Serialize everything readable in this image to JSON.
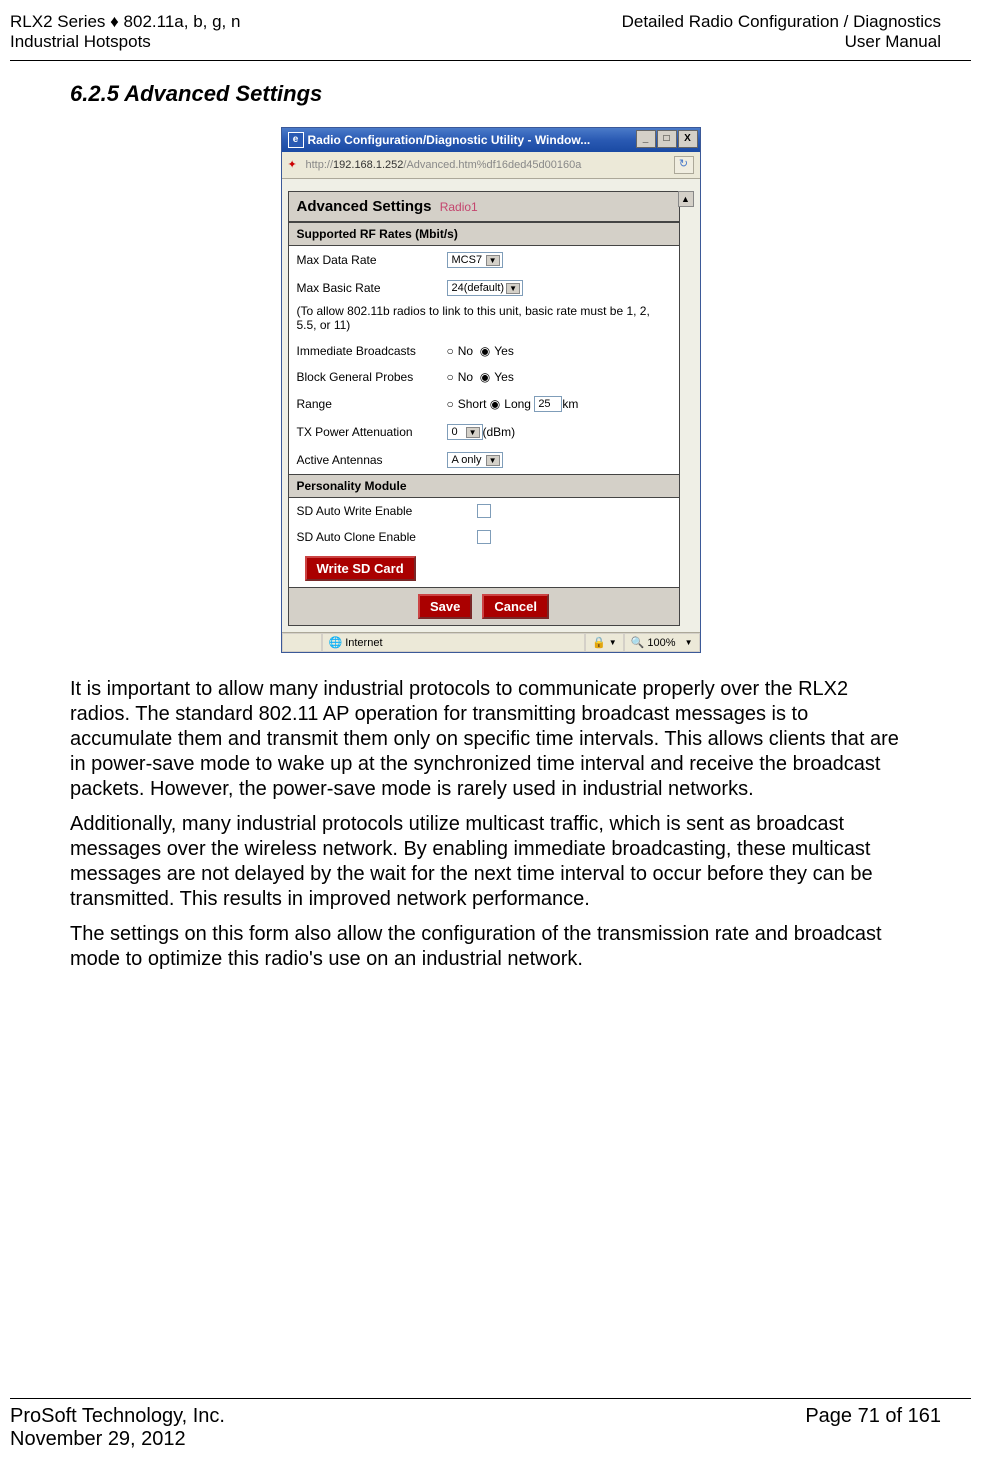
{
  "header": {
    "left_line1": "RLX2 Series ♦ 802.11a, b, g, n",
    "left_line2": "Industrial Hotspots",
    "right_line1": "Detailed Radio Configuration / Diagnostics",
    "right_line2": "User Manual"
  },
  "section": {
    "number_title": "6.2.5   Advanced Settings"
  },
  "window": {
    "title": "Radio Configuration/Diagnostic Utility - Window...",
    "url_prefix": "http://",
    "url_host": "192.168.1.252",
    "url_path": "/Advanced.htm%df16ded45d00160a",
    "panel_title": "Advanced Settings",
    "radio_name": "Radio1",
    "rf_rates_header": "Supported RF Rates (Mbit/s)",
    "max_data_rate_label": "Max Data Rate",
    "max_data_rate_value": "MCS7",
    "max_basic_rate_label": "Max Basic Rate",
    "max_basic_rate_value": "24(default)",
    "basic_rate_note": "(To allow 802.11b radios to link to this unit, basic rate must be 1, 2, 5.5, or 11)",
    "immediate_broadcasts_label": "Immediate Broadcasts",
    "block_general_probes_label": "Block General Probes",
    "opt_no": "No",
    "opt_yes": "Yes",
    "range_label": "Range",
    "range_short": "Short",
    "range_long": "Long",
    "range_value": "25",
    "range_unit": "km",
    "tx_power_label": "TX Power Attenuation",
    "tx_power_value": "0",
    "tx_power_unit": "(dBm)",
    "active_antennas_label": "Active Antennas",
    "active_antennas_value": "A only",
    "personality_header": "Personality Module",
    "sd_auto_write_label": "SD Auto Write Enable",
    "sd_auto_clone_label": "SD Auto Clone Enable",
    "write_sd_btn": "Write SD Card",
    "save_btn": "Save",
    "cancel_btn": "Cancel",
    "status_internet": "Internet",
    "status_zoom": "100%"
  },
  "paragraphs": {
    "p1": "It is important to allow many industrial protocols to communicate properly over the RLX2 radios. The standard 802.11 AP operation for transmitting broadcast messages is to accumulate them and transmit them only on specific time intervals. This allows clients that are in power-save mode to wake up at the synchronized time interval and receive the broadcast packets. However, the power-save mode is rarely used in industrial networks.",
    "p2": "Additionally, many industrial protocols utilize multicast traffic, which is sent as broadcast messages over the wireless network. By enabling immediate broadcasting, these multicast messages are not delayed by the wait for the next time interval to occur before they can be transmitted. This results in improved network performance.",
    "p3": "The settings on this form also allow the configuration of the transmission rate and broadcast mode to optimize this radio's use on an industrial network."
  },
  "footer": {
    "left_line1": "ProSoft Technology, Inc.",
    "left_line2": "November 29, 2012",
    "right_line1": "Page 71 of 161"
  }
}
